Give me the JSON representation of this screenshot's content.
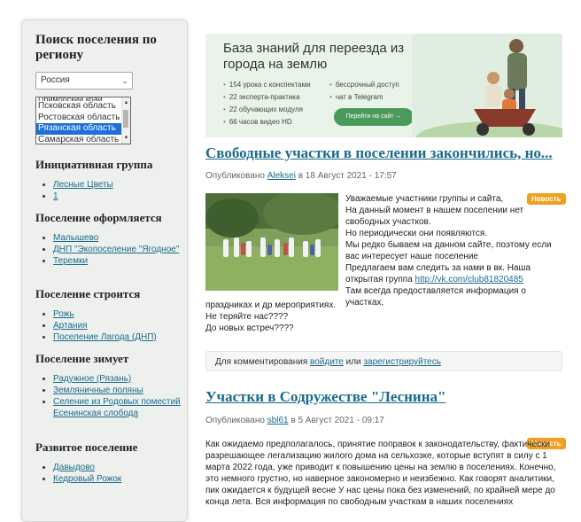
{
  "sidebar": {
    "title": "Поиск поселения по региону",
    "country": "Россия",
    "regions_partial": "Приморский край",
    "regions": [
      "Псковская область",
      "Ростовская область",
      "Рязанская область",
      "Самарская область"
    ],
    "selected_region": "Рязанская область",
    "sections": [
      {
        "title": "Инициативная группа",
        "items": [
          "Лесные Цветы",
          "1"
        ]
      },
      {
        "title": "Поселение оформляется",
        "items": [
          "Малышево",
          "ДНП \"Экопоселение \"Ягодное\"",
          "Теремки"
        ]
      },
      {
        "title": "Поселение строится",
        "items": [
          "Рожь",
          "Артания",
          "Поселение Лагода (ДНП)"
        ]
      },
      {
        "title": "Поселение зимует",
        "items": [
          "Радужное (Рязань)",
          "Земляничные поляны",
          "Селение из Родовых поместий Есенинская слобода"
        ]
      },
      {
        "title": "Развитое поселение",
        "items": [
          "Давыдово",
          "Кедровый Рожок"
        ]
      }
    ]
  },
  "banner": {
    "title": "База знаний для переезда из города на землю",
    "features_left": [
      "154 урока с конспектами",
      "22 эксперта-практика",
      "22 обучающих модуля",
      "66 часов видео HD"
    ],
    "features_right": [
      "бессрочный доступ",
      "чат в Telegram"
    ],
    "cta": "Перейти на сайт →"
  },
  "posts": [
    {
      "title": "Свободные участки в поселении закончились, но...",
      "published_prefix": "Опубликовано",
      "author": "Aleksei",
      "date": "в 18 Август 2021 - 17:57",
      "badge": "Новость",
      "lines": [
        "Уважаемые участники группы и сайта,",
        "На данный момент в нашем поселении нет свободных участков.",
        "Но периодически они появляются.",
        "Мы редко бываем на данном сайте, поэтому если вас интересует наше поселение",
        "Предлагаем вам следить за нами в вк. Наша открытая группа",
        "Там всегда предоставляется информация о участках,"
      ],
      "link": "http://vk.com/club81820485",
      "tail": [
        "праздниках и др мероприятиях.",
        "Не теряйте нас????",
        "До новых встреч????"
      ]
    },
    {
      "title": "Участки в Содружестве \"Леснина\"",
      "published_prefix": "Опубликовано",
      "author": "sbl61",
      "date": "в 5 Август 2021 - 09:17",
      "badge": "Новость",
      "text": "Как ожидаемо предполагалось, принятие поправок к законодательству, фактически разрешающее легализацию жилого дома на сельхозке, которые вступят в силу с 1 марта 2022 года, уже приводит к повышению цены на землю в поселениях. Конечно, это немного грустно, но наверное закономерно и неизбежно. Как говорят аналитики, пик ожидается к будущей весне У нас цены пока без изменений, по крайней мере до конца лета. Вся информация по свободным участкам в наших поселениях"
    }
  ],
  "comments": {
    "prefix": "Для комментирования",
    "login": "войдите",
    "or": "или",
    "register": "зарегистрируйтесь"
  }
}
